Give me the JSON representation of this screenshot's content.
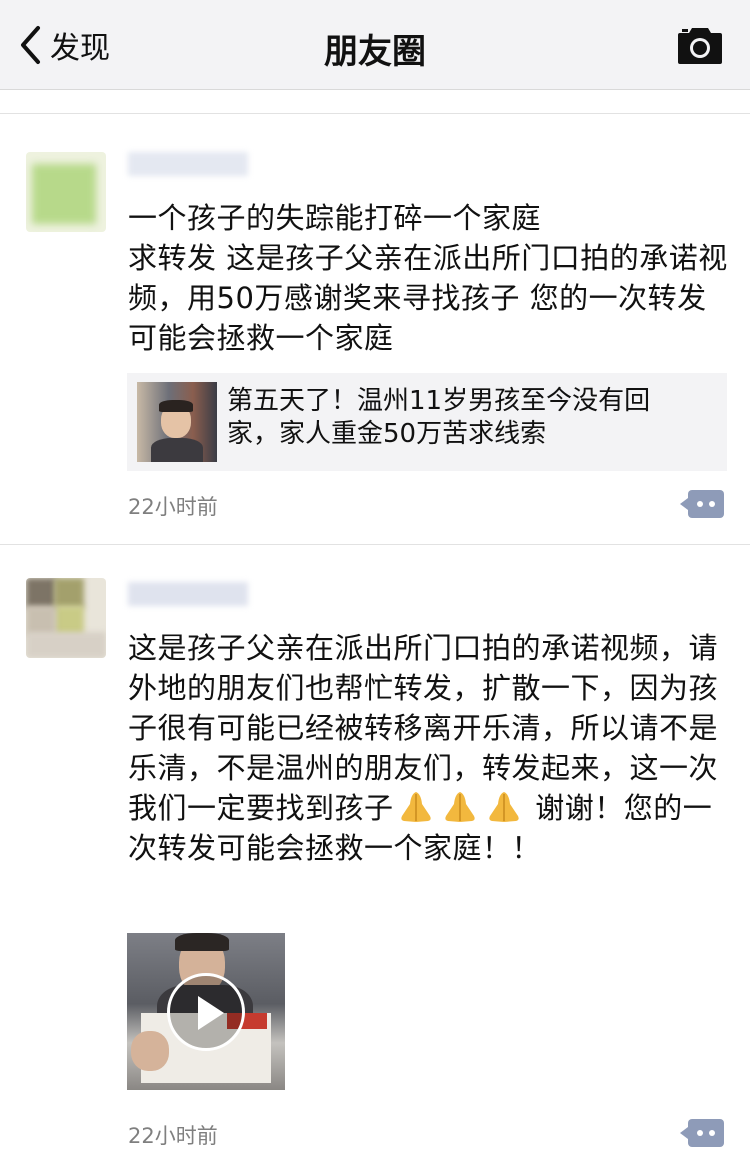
{
  "navbar": {
    "back_label": "发现",
    "title": "朋友圈",
    "back_icon": "chevron-left-icon",
    "camera_icon": "camera-icon"
  },
  "posts": [
    {
      "text": "一个孩子的失踪能打碎一个家庭\n求转发 这是孩子父亲在派出所门口拍的承诺视频，用50万感谢奖来寻找孩子 您的一次转发可能会拯救一个家庭",
      "share_card": {
        "title": "第五天了！温州11岁男孩至今没有回家，家人重金50万苦求线索"
      },
      "time": "22小时前",
      "comment_icon": "comment-icon"
    },
    {
      "text_part1": "这是孩子父亲在派出所门口拍的承诺视频，请外地的朋友们也帮忙转发，扩散一下，因为孩子很有可能已经被转移离开乐清，所以请不是乐清，不是温州的朋友们，转发起来，这一次我们一定要找到孩子",
      "emoji": "🙏🙏🙏",
      "text_part2": "谢谢！您的一次转发可能会拯救一个家庭！！",
      "video_icon": "play-icon",
      "time": "22小时前",
      "comment_icon": "comment-icon"
    }
  ]
}
